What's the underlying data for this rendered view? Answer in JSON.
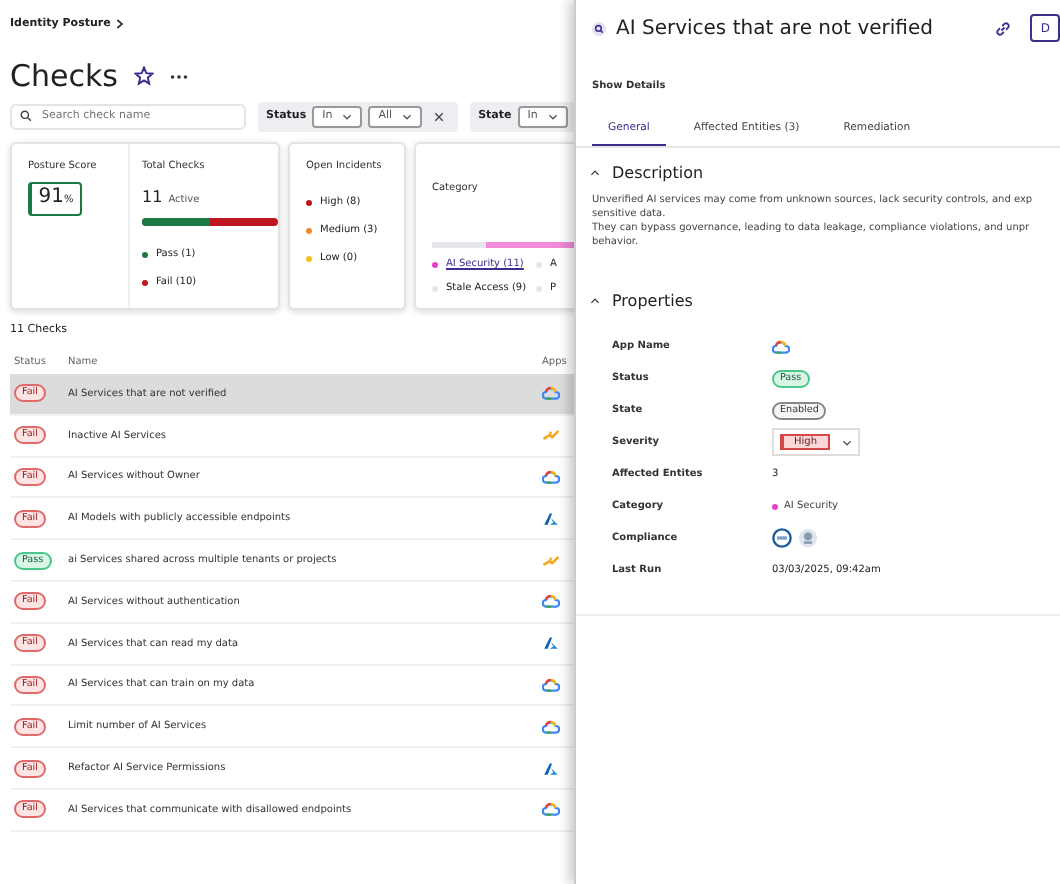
{
  "breadcrumb": "Identity Posture",
  "page_title": "Checks",
  "search": {
    "placeholder": "Search check name"
  },
  "filters": [
    {
      "label": "Status",
      "operator": "In",
      "value": "All",
      "clearable": true
    },
    {
      "label": "State",
      "operator": "In"
    }
  ],
  "posture_score": {
    "title": "Posture Score",
    "value": "91",
    "unit": "%"
  },
  "total_checks": {
    "title": "Total Checks",
    "count": "11",
    "count_label": "Active",
    "level": 0.5,
    "legend": [
      {
        "label": "Pass (1)",
        "color": "#1e7a45"
      },
      {
        "label": "Fail (10)",
        "color": "#c0161f"
      }
    ]
  },
  "open_incidents": {
    "title": "Open Incidents",
    "items": [
      {
        "label": "High (8)",
        "color": "#c0161f"
      },
      {
        "label": "Medium (3)",
        "color": "#f0892c"
      },
      {
        "label": "Low (0)",
        "color": "#f5c026"
      }
    ]
  },
  "category": {
    "title": "Category",
    "level": 0.7,
    "items": [
      {
        "label": "AI Security (11)",
        "color": "#e83fc8",
        "link": true
      },
      {
        "label": "A",
        "color": "#e3e5ea"
      },
      {
        "label": "Stale Access (9)",
        "color": "#e3e5ea",
        "link": false
      },
      {
        "label": "P",
        "color": "#e3e5ea"
      }
    ]
  },
  "table": {
    "count": "11 Checks",
    "columns": [
      "Status",
      "Name",
      "Apps"
    ],
    "rows": [
      {
        "status": "Fail",
        "kind": "fail",
        "name": "AI Services that are not verified",
        "app": {
          "kind": "cloud"
        },
        "selected": true
      },
      {
        "status": "Fail",
        "kind": "fail",
        "name": "Inactive AI Services",
        "app": {
          "kind": "plug"
        },
        "selected": false
      },
      {
        "status": "Fail",
        "kind": "fail",
        "name": "AI Services without Owner",
        "app": {
          "kind": "cloud"
        },
        "selected": false
      },
      {
        "status": "Fail",
        "kind": "fail",
        "name": "AI Models with publicly accessible endpoints",
        "app": {
          "kind": "a-logo"
        },
        "selected": false
      },
      {
        "status": "Pass",
        "kind": "pass",
        "name": "ai Services shared across multiple tenants or projects",
        "app": {
          "kind": "plug"
        },
        "selected": false
      },
      {
        "status": "Fail",
        "kind": "fail",
        "name": "AI Services without authentication",
        "app": {
          "kind": "cloud"
        },
        "selected": false
      },
      {
        "status": "Fail",
        "kind": "fail",
        "name": "AI Services that can read my data",
        "app": {
          "kind": "a-logo"
        },
        "selected": false
      },
      {
        "status": "Fail",
        "kind": "fail",
        "name": "AI Services that can train on my data",
        "app": {
          "kind": "cloud"
        },
        "selected": false
      },
      {
        "status": "Fail",
        "kind": "fail",
        "name": "Limit number of AI Services",
        "app": {
          "kind": "cloud"
        },
        "selected": false
      },
      {
        "status": "Fail",
        "kind": "fail",
        "name": "Refactor AI Service Permissions",
        "app": {
          "kind": "a-logo"
        },
        "selected": false
      },
      {
        "status": "Fail",
        "kind": "fail",
        "name": "AI Services that communicate with disallowed endpoints",
        "app": {
          "kind": "cloud"
        },
        "selected": false
      }
    ]
  },
  "detail": {
    "title": "AI Services that are not verified",
    "action_button": "D",
    "show_details": "Show Details",
    "tabs": [
      {
        "label": "General",
        "selected": true
      },
      {
        "label": "Affected Entities (3)",
        "selected": false
      },
      {
        "label": "Remediation",
        "selected": false
      }
    ],
    "description": {
      "heading": "Description",
      "expanded": true,
      "paragraphs": [
        "Unverified AI services may come from unknown sources, lack security controls, and exp sensitive data.",
        "They can bypass governance, leading to data leakage, compliance violations, and unpr behavior."
      ]
    },
    "properties": {
      "heading": "Properties",
      "expanded": true,
      "rows": [
        {
          "kind": "app",
          "label": "App Name",
          "app": {
            "kind": "cloud"
          }
        },
        {
          "kind": "pass-pill",
          "label": "Status",
          "value": "Pass"
        },
        {
          "kind": "neutral-pill",
          "label": "State",
          "value": "Enabled"
        },
        {
          "kind": "select",
          "label": "Severity",
          "value": "High"
        },
        {
          "kind": "text",
          "label": "Affected Entites",
          "value": "3"
        },
        {
          "kind": "dot",
          "label": "Category",
          "value": "AI Security",
          "color": "#e83fc8"
        },
        {
          "kind": "badges",
          "label": "Compliance"
        },
        {
          "kind": "text",
          "label": "Last Run",
          "value": "03/03/2025, 09:42am"
        }
      ]
    }
  }
}
